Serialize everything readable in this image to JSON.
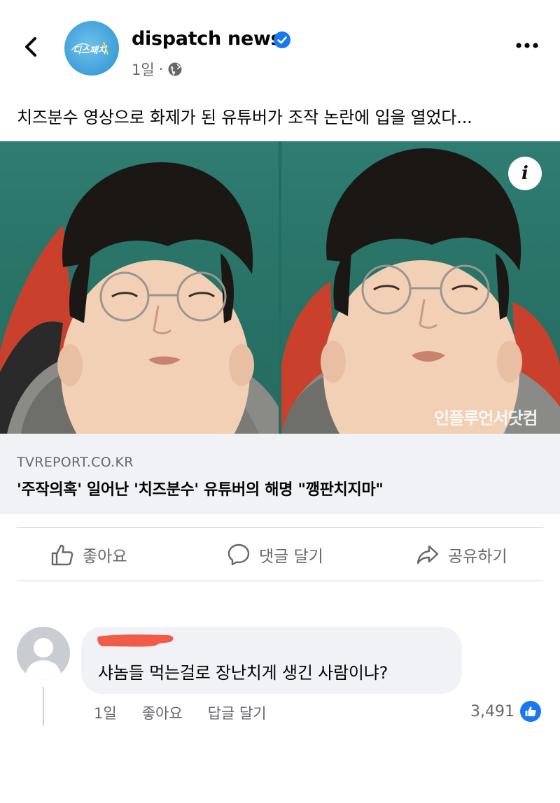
{
  "header": {
    "page_name": "dispatch news",
    "time": "1일",
    "separator": "·",
    "avatar_logo_text": "디스패치"
  },
  "icons": {
    "back": "back-arrow-icon",
    "verified": "verified-badge-icon",
    "audience": "globe-icon",
    "more": "more-options-icon",
    "info": "info-icon",
    "like": "thumbs-up-icon",
    "comment": "comment-icon",
    "share": "share-icon"
  },
  "post": {
    "text": "치즈분수 영상으로 화제가 된 유튜버가 조작 논란에 입을 열었다..."
  },
  "media": {
    "info_label": "i",
    "watermark": "인플루언서닷컴"
  },
  "link": {
    "domain": "TVREPORT.CO.KR",
    "title": "'주작의혹' 일어난 '치즈분수' 유튜버의 해명 \"깽판치지마\""
  },
  "actions": {
    "like": "좋아요",
    "comment": "댓글 달기",
    "share": "공유하기"
  },
  "comment": {
    "text": "샤놈들 먹는걸로 장난치게 생긴 사람이냐?",
    "time": "1일",
    "like": "좋아요",
    "reply": "답글 달기",
    "reaction_count": "3,491"
  },
  "colors": {
    "brand_blue": "#1877f2",
    "secondary_text": "#65676b",
    "link_box_bg": "#f0f2f5",
    "redaction": "#f25a4a"
  }
}
